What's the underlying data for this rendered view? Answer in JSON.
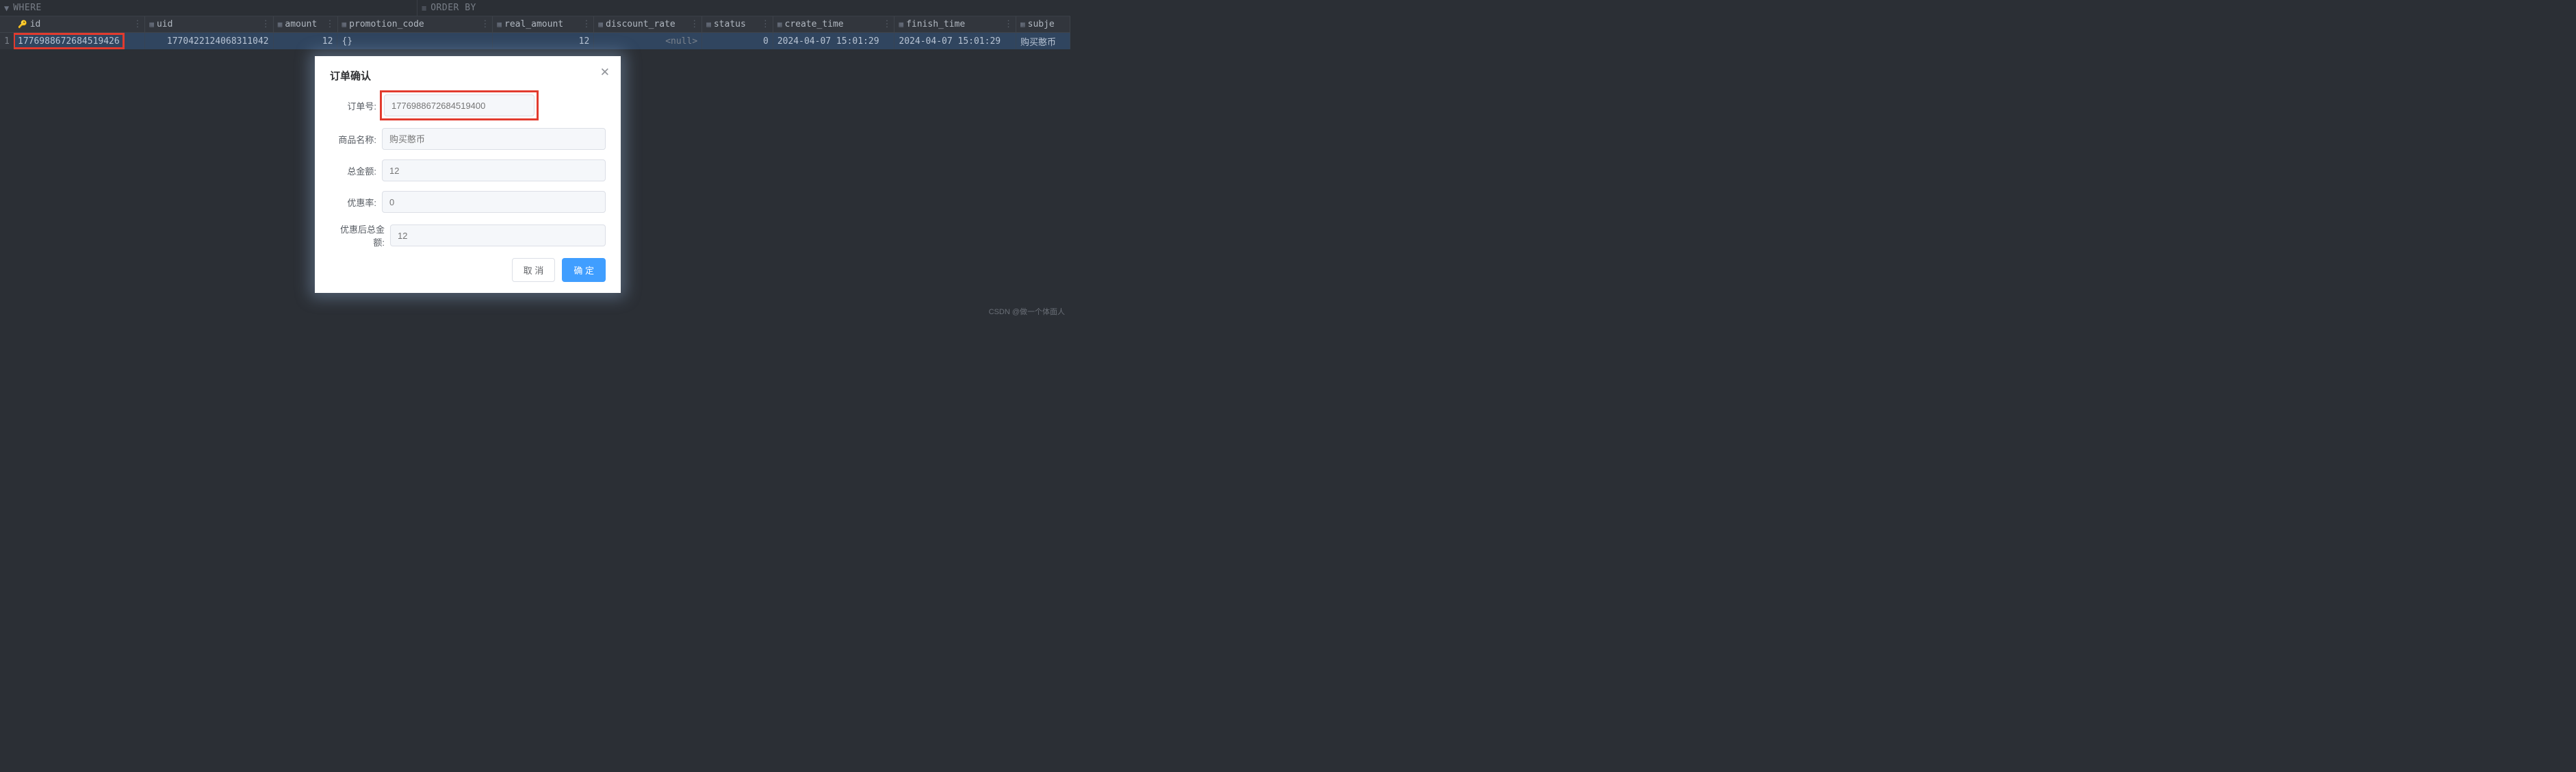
{
  "filters": {
    "where_label": "WHERE",
    "orderby_label": "ORDER BY"
  },
  "columns": [
    {
      "name": "id",
      "pk": true
    },
    {
      "name": "uid"
    },
    {
      "name": "amount"
    },
    {
      "name": "promotion_code"
    },
    {
      "name": "real_amount"
    },
    {
      "name": "discount_rate"
    },
    {
      "name": "status"
    },
    {
      "name": "create_time"
    },
    {
      "name": "finish_time"
    },
    {
      "name": "subje"
    }
  ],
  "row": {
    "num": "1",
    "id": "1776988672684519426",
    "uid": "1770422124068311042",
    "amount": "12",
    "promotion_code": "{}",
    "real_amount": "12",
    "discount_rate": "<null>",
    "status": "0",
    "create_time": "2024-04-07 15:01:29",
    "finish_time": "2024-04-07 15:01:29",
    "subject": "购买憨币"
  },
  "modal": {
    "title": "订单确认",
    "fields": {
      "order_no_label": "订单号:",
      "order_no_placeholder": "1776988672684519400",
      "product_label": "商品名称:",
      "product_placeholder": "购买憨币",
      "total_label": "总金额:",
      "total_placeholder": "12",
      "discount_label": "优惠率:",
      "discount_placeholder": "0",
      "final_label": "优惠后总金额:",
      "final_placeholder": "12"
    },
    "cancel_label": "取 消",
    "ok_label": "确 定"
  },
  "watermark": "CSDN @做一个体面人"
}
